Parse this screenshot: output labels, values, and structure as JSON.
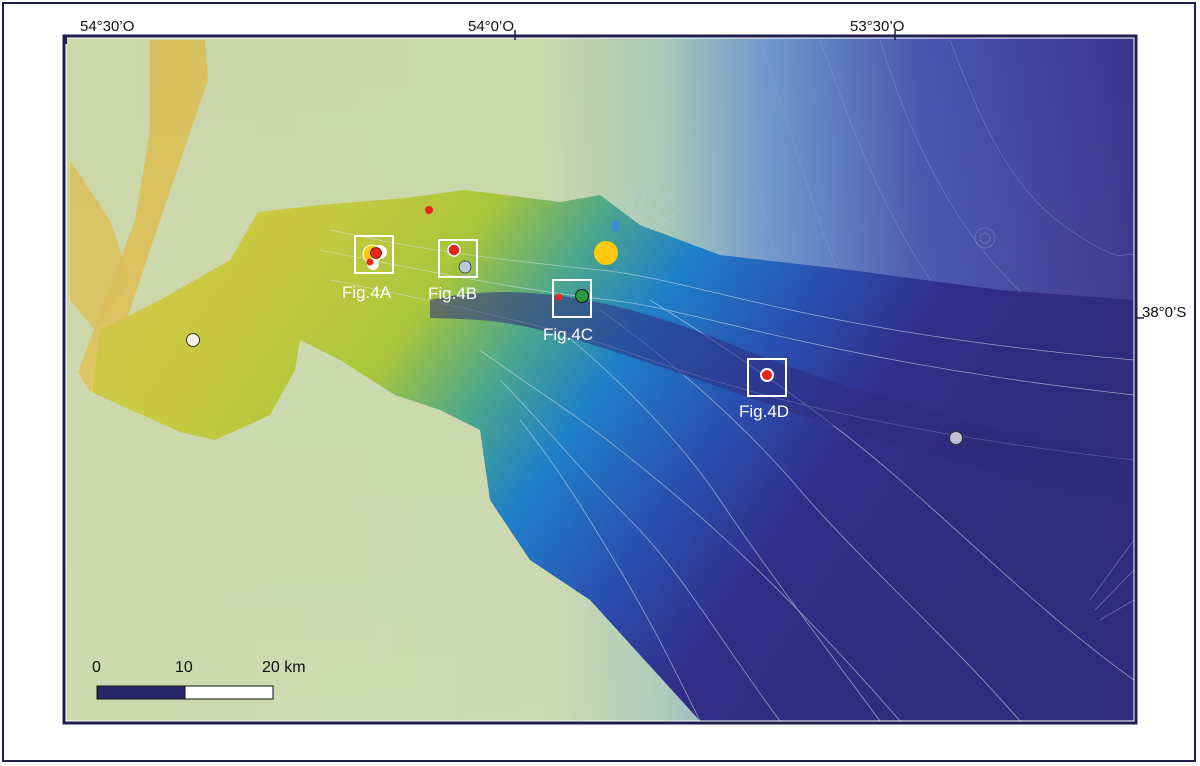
{
  "coordinates": {
    "longitude_ticks": [
      "54°30’O",
      "54°0’O",
      "53°30’O"
    ],
    "latitude_ticks": [
      "38°0’S"
    ]
  },
  "figure_boxes": [
    {
      "label": "Fig.4A"
    },
    {
      "label": "Fig.4B"
    },
    {
      "label": "Fig.4C"
    },
    {
      "label": "Fig.4D"
    }
  ],
  "scale_bar": {
    "ticks": [
      "0",
      "10",
      "20 km"
    ],
    "dark_color": "#262668",
    "light_color": "#ffffff"
  },
  "colors": {
    "frame": "#1e1e4f",
    "land_background": "#c9d5a8",
    "shallow": "#c9c43c",
    "mid": "#2e86c2",
    "deep": "#33297a",
    "site_red": "#e8261e",
    "site_yellow": "#ffc90e",
    "site_green": "#2a9a3f",
    "site_lightblue": "#b8c8d8",
    "site_white": "#f2f1e0",
    "site_lavender": "#c3bfd8"
  },
  "markers": [
    {
      "type": "red-dot",
      "color": "#e8261e"
    },
    {
      "type": "yellow-dot",
      "color": "#ffc90e"
    },
    {
      "type": "green-dot",
      "color": "#2a9a3f"
    },
    {
      "type": "light-blue-dot",
      "color": "#b8c8d8"
    },
    {
      "type": "white-dot",
      "color": "#f2f1e0"
    },
    {
      "type": "lavender-dot",
      "color": "#c3bfd8"
    }
  ]
}
